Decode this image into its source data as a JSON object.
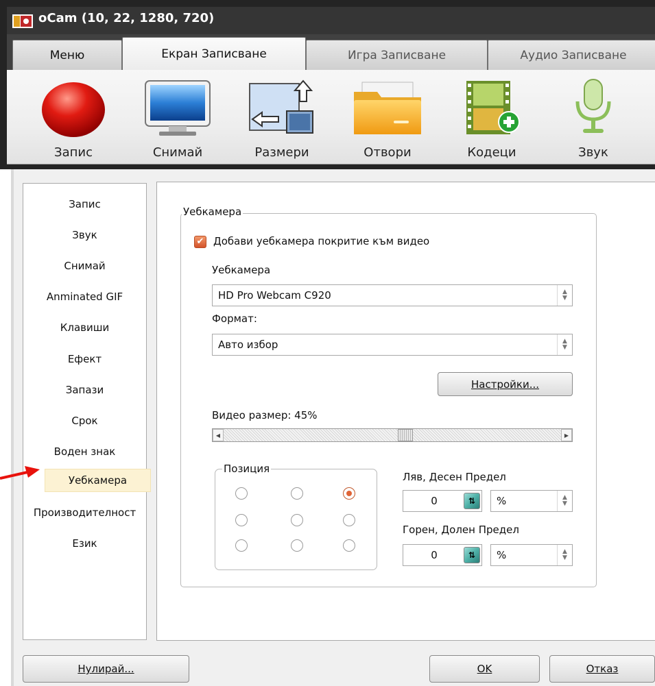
{
  "window": {
    "title": "oCam (10, 22, 1280, 720)"
  },
  "tabs": [
    {
      "label": "Меню"
    },
    {
      "label": "Екран Записване"
    },
    {
      "label": "Игра Записване"
    },
    {
      "label": "Аудио Записване"
    }
  ],
  "toolbar": [
    {
      "label": "Запис",
      "icon": "record-icon"
    },
    {
      "label": "Снимай",
      "icon": "monitor-icon"
    },
    {
      "label": "Размери",
      "icon": "resize-icon"
    },
    {
      "label": "Отвори",
      "icon": "folder-icon"
    },
    {
      "label": "Кодеци",
      "icon": "codec-icon"
    },
    {
      "label": "Звук",
      "icon": "microphone-icon"
    }
  ],
  "nav": {
    "items": [
      {
        "label": "Запис"
      },
      {
        "label": "Звук"
      },
      {
        "label": "Снимай"
      },
      {
        "label": "Anminated GIF"
      },
      {
        "label": "Клавиши"
      },
      {
        "label": "Ефект"
      },
      {
        "label": "Запази"
      },
      {
        "label": "Срок"
      },
      {
        "label": "Воден знак"
      },
      {
        "label": "Уебкамера"
      },
      {
        "label": "Производителност"
      },
      {
        "label": "Език"
      }
    ],
    "selected": "Уебкамера"
  },
  "webcam": {
    "group_title": "Уебкамера",
    "overlay_checkbox": {
      "label": "Добави уебкамера покритие към видео",
      "checked": true
    },
    "device_label": "Уебкамера",
    "device_value": "HD Pro Webcam C920",
    "format_label": "Формат:",
    "format_value": "Авто избор",
    "settings_button": "Настройки...",
    "video_size_label": "Видео размер: 45%",
    "video_size_percent": 45,
    "position": {
      "title": "Позиция",
      "selected_index": 2
    },
    "lr_margin": {
      "label": "Ляв, Десен Предел",
      "value": "0",
      "unit": "%"
    },
    "tb_margin": {
      "label": "Горен, Долен Предел",
      "value": "0",
      "unit": "%"
    }
  },
  "footer": {
    "reset_button": "Нулирай...",
    "ok_button": "OK",
    "cancel_button": "Отказ"
  },
  "colors": {
    "accent": "#e06436",
    "selected_bg": "#fcf2d3",
    "arrow": "#e8120c"
  }
}
